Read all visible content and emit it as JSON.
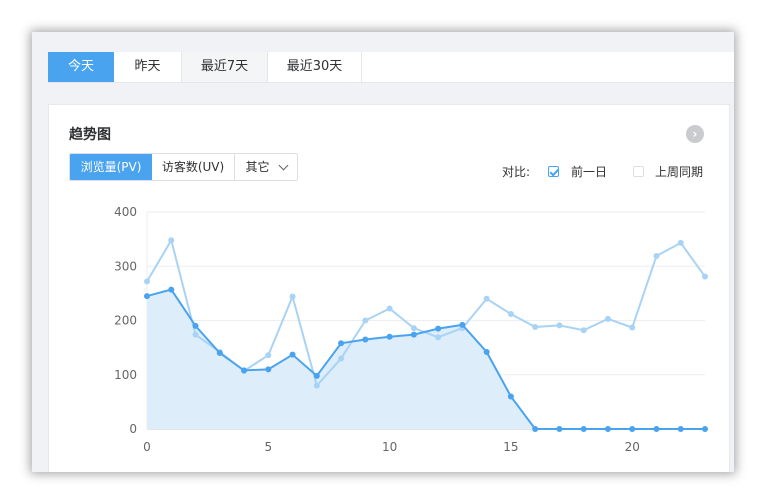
{
  "tabs": [
    "今天",
    "昨天",
    "最近7天",
    "最近30天"
  ],
  "card": {
    "title": "趋势图",
    "metrics": [
      "浏览量(PV)",
      "访客数(UV)",
      "其它"
    ],
    "compare_label": "对比:",
    "compare_options": [
      {
        "label": "前一日",
        "checked": true
      },
      {
        "label": "上周同期",
        "checked": false
      }
    ]
  },
  "colors": {
    "accent": "#4aa3ef",
    "series_today": "#4aa3ef",
    "series_yesterday": "#a9d3f5",
    "area_fill": "#ddeefa"
  },
  "chart_data": {
    "type": "line",
    "x": [
      0,
      1,
      2,
      3,
      4,
      5,
      6,
      7,
      8,
      9,
      10,
      11,
      12,
      13,
      14,
      15,
      16,
      17,
      18,
      19,
      20,
      21,
      22,
      23
    ],
    "x_ticks": [
      0,
      5,
      10,
      15,
      20
    ],
    "y_ticks": [
      0,
      100,
      200,
      300,
      400
    ],
    "ylim": [
      0,
      400
    ],
    "xlim": [
      0,
      23
    ],
    "series": [
      {
        "values": [
          245,
          257,
          190,
          140,
          108,
          110,
          137,
          98,
          158,
          165,
          170,
          174,
          185,
          192,
          142,
          60,
          0,
          0,
          0,
          0,
          0,
          0,
          0,
          0
        ],
        "area": true
      },
      {
        "values": [
          272,
          348,
          174,
          142,
          107,
          136,
          244,
          80,
          130,
          200,
          222,
          186,
          169,
          186,
          240,
          212,
          188,
          191,
          182,
          203,
          187,
          319,
          343,
          281
        ],
        "area": false
      }
    ],
    "grid": true
  }
}
